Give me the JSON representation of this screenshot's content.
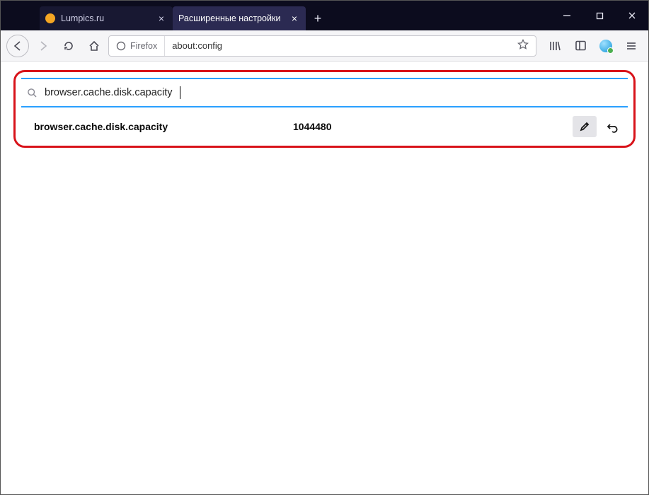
{
  "window": {
    "tabs": [
      {
        "title": "Lumpics.ru",
        "active": false,
        "favicon_color": "#f5a623"
      },
      {
        "title": "Расширенные настройки",
        "active": true,
        "favicon_color": "transparent"
      }
    ]
  },
  "nav": {
    "identity_label": "Firefox",
    "url": "about:config"
  },
  "config": {
    "search_value": "browser.cache.disk.capacity",
    "pref": {
      "name": "browser.cache.disk.capacity",
      "value": "1044480"
    }
  },
  "icons": {
    "search": "search-icon",
    "edit": "pencil-icon",
    "reset": "undo-icon"
  }
}
